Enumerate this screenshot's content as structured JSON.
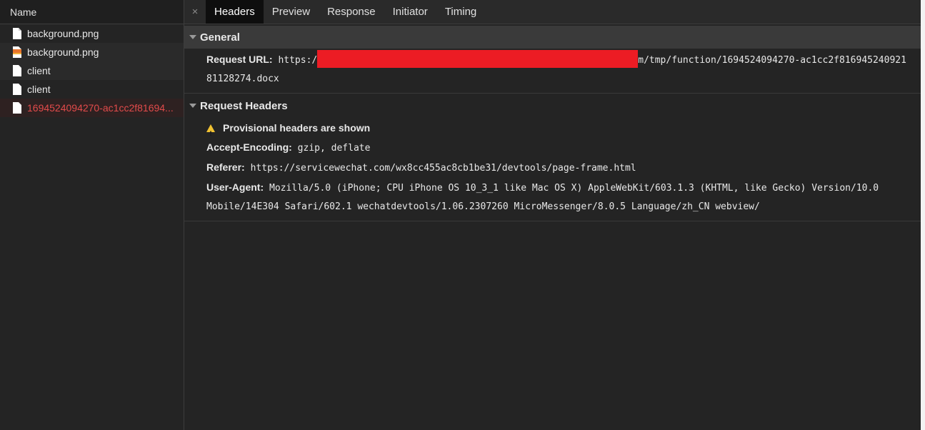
{
  "left_panel": {
    "header": "Name",
    "files": [
      {
        "name": "background.png",
        "icon": "file-icon",
        "state": "normal"
      },
      {
        "name": "background.png",
        "icon": "image-file-icon",
        "state": "normal"
      },
      {
        "name": "client",
        "icon": "file-icon",
        "state": "normal"
      },
      {
        "name": "client",
        "icon": "file-icon",
        "state": "normal"
      },
      {
        "name": "1694524094270-ac1cc2f81694...",
        "icon": "file-icon",
        "state": "error"
      }
    ]
  },
  "tabs": {
    "close": "×",
    "items": [
      "Headers",
      "Preview",
      "Response",
      "Initiator",
      "Timing"
    ],
    "active": "Headers"
  },
  "general": {
    "title": "General",
    "request_url_label": "Request URL:",
    "request_url_prefix": "https:/",
    "request_url_suffix": "m/tmp/function/1694524094270-ac1cc2f816945240921",
    "request_url_line2": "81128274.docx"
  },
  "request_headers": {
    "title": "Request Headers",
    "warning": "Provisional headers are shown",
    "accept_encoding_label": "Accept-Encoding:",
    "accept_encoding_value": "gzip, deflate",
    "referer_label": "Referer:",
    "referer_value": "https://servicewechat.com/wx8cc455ac8cb1be31/devtools/page-frame.html",
    "user_agent_label": "User-Agent:",
    "user_agent_line1": "Mozilla/5.0 (iPhone; CPU iPhone OS 10_3_1 like Mac OS X) AppleWebKit/603.1.3 (KHTML, like Gecko) Version/10.0",
    "user_agent_line2": "Mobile/14E304 Safari/602.1 wechatdevtools/1.06.2307260 MicroMessenger/8.0.5 Language/zh_CN webview/"
  },
  "colors": {
    "error_text": "#e24b4b",
    "redaction": "#ec1c24",
    "warning": "#f1c232"
  }
}
